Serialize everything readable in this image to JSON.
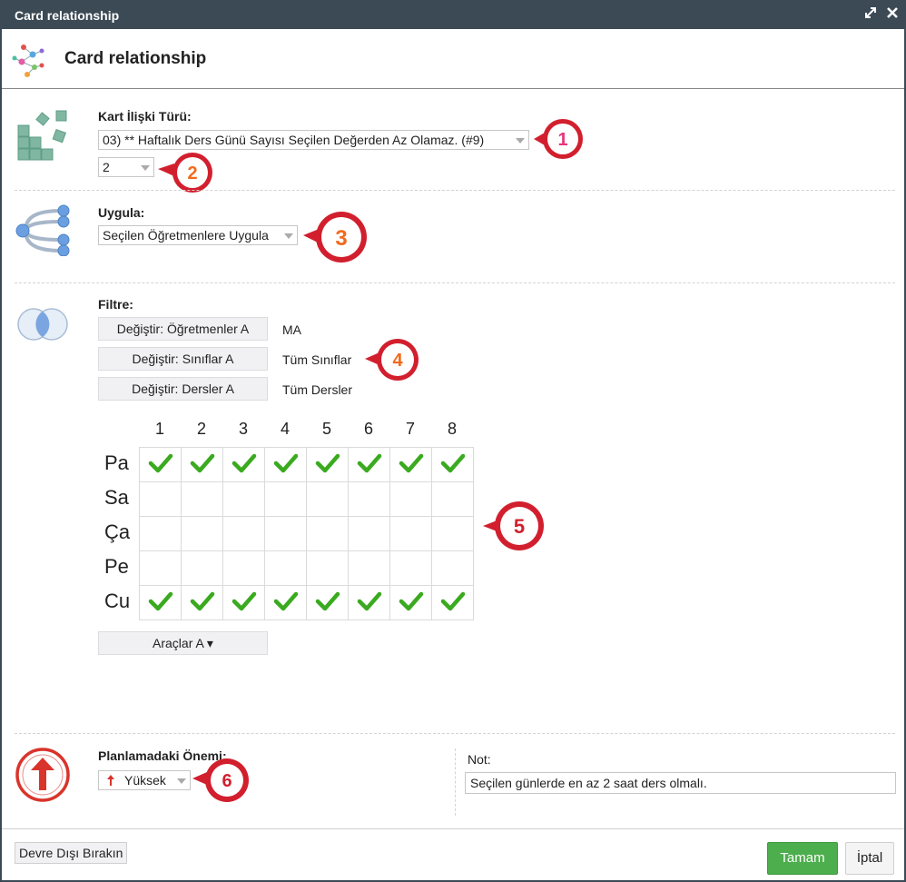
{
  "window": {
    "title": "Card relationship"
  },
  "header": {
    "title": "Card relationship"
  },
  "relation": {
    "label": "Kart İlişki Türü:",
    "type_value": "03) ** Haftalık Ders Günü Sayısı Seçilen Değerden Az Olamaz. (#9)",
    "count_value": "2"
  },
  "apply": {
    "label": "Uygula:",
    "value": "Seçilen Öğretmenlere Uygula"
  },
  "filter": {
    "label": "Filtre:",
    "rows": [
      {
        "button": "Değiştir: Öğretmenler A",
        "value": "MA"
      },
      {
        "button": "Değiştir: Sınıflar A",
        "value": "Tüm Sınıflar"
      },
      {
        "button": "Değiştir: Dersler A",
        "value": "Tüm Dersler"
      }
    ]
  },
  "grid": {
    "columns": [
      "1",
      "2",
      "3",
      "4",
      "5",
      "6",
      "7",
      "8"
    ],
    "rows": [
      {
        "label": "Pa",
        "checked": [
          true,
          true,
          true,
          true,
          true,
          true,
          true,
          true
        ]
      },
      {
        "label": "Sa",
        "checked": [
          false,
          false,
          false,
          false,
          false,
          false,
          false,
          false
        ]
      },
      {
        "label": "Ça",
        "checked": [
          false,
          false,
          false,
          false,
          false,
          false,
          false,
          false
        ]
      },
      {
        "label": "Pe",
        "checked": [
          false,
          false,
          false,
          false,
          false,
          false,
          false,
          false
        ]
      },
      {
        "label": "Cu",
        "checked": [
          true,
          true,
          true,
          true,
          true,
          true,
          true,
          true
        ]
      }
    ],
    "check_color": "#3aaa1f",
    "tools_label": "Araçlar A ▾"
  },
  "importance": {
    "label": "Planlamadaki Önemi:",
    "value": "Yüksek",
    "color": "#d9342b"
  },
  "note": {
    "label": "Not:",
    "value": "Seçilen günlerde en az 2 saat ders olmalı."
  },
  "callouts": [
    "1",
    "2",
    "3",
    "4",
    "5",
    "6"
  ],
  "callout_colors": {
    "ring": "#d21f2e",
    "number_pink": "#e8347a",
    "number_orange": "#f26a1b"
  },
  "footer": {
    "disable_label": "Devre Dışı Bırakın",
    "ok_label": "Tamam",
    "cancel_label": "İptal"
  }
}
